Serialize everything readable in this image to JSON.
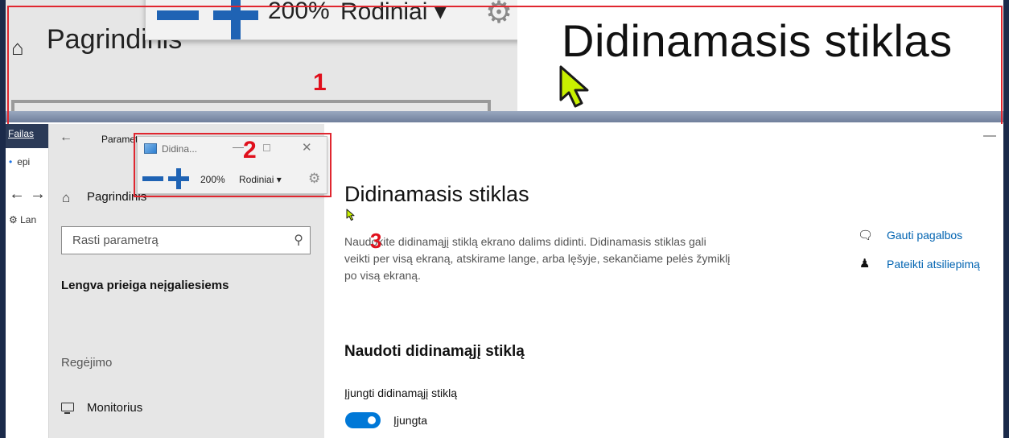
{
  "zoomed_view": {
    "nav_home_label": "Pagrindinis",
    "toolbar_percent": "200%",
    "toolbar_views": "Rodiniai ▾",
    "title": "Didinamasis stiklas"
  },
  "annotations": {
    "box1_number": "1",
    "box2_number": "2",
    "marker3_number": "3"
  },
  "background_app": {
    "menu_file": "Failas",
    "tab_title": "epi",
    "bookmark": "Lan"
  },
  "settings": {
    "window_title": "Paramet",
    "home_label": "Pagrindinis",
    "search_placeholder": "Rasti parametrą",
    "category": "Lengva prieiga neįgaliesiems",
    "section_vision": "Regėjimo",
    "monitor_label": "Monitorius",
    "page_title": "Didinamasis stiklas",
    "description": "Naudokite didinamąjį stiklą ekrano dalims didinti. Didinamasis stiklas gali veikti per visą ekraną, atskirame lange, arba lęšyje, sekančiame pelės žymiklį po visą ekraną.",
    "help_link": "Gauti pagalbos",
    "feedback_link": "Pateikti atsiliepimą",
    "use_heading": "Naudoti didinamąjį stiklą",
    "toggle_label": "Įjungti didinamąjį stiklą",
    "toggle_state": "Įjungta",
    "toggle_on": true
  },
  "magnifier_toolbar": {
    "title": "Didina...",
    "percent": "200%",
    "views": "Rodiniai ▾"
  },
  "icons": {
    "home": "home-icon",
    "search": "search-icon",
    "gear": "gear-icon",
    "help": "help-chat-icon",
    "feedback": "feedback-person-icon",
    "monitor": "monitor-icon",
    "back": "back-arrow-icon",
    "cursor": "mouse-pointer-icon"
  },
  "colors": {
    "accent_blue": "#0078d7",
    "link_blue": "#0063b1",
    "magnifier_blue": "#1f63b4",
    "annotation_red": "#e0262f",
    "cursor_yellow_green": "#c8f000",
    "sidebar_gray": "#e6e6e6"
  }
}
